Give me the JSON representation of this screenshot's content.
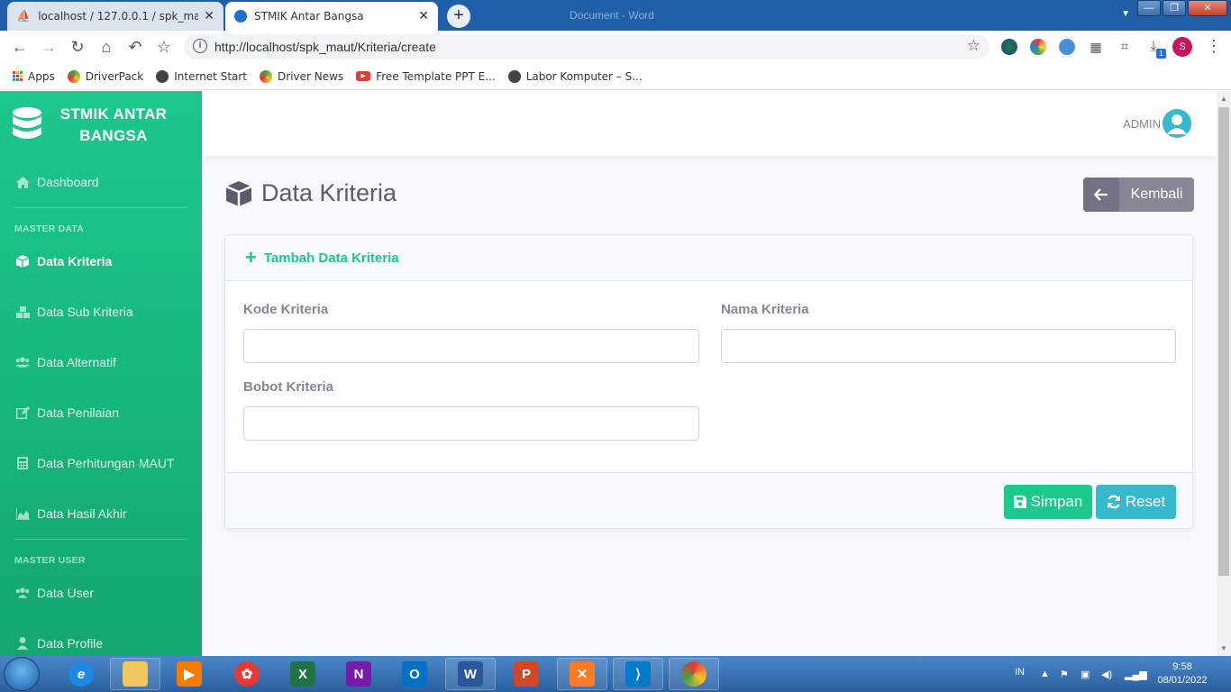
{
  "browser": {
    "tabs": [
      {
        "title": "localhost / 127.0.0.1 / spk_maut_"
      },
      {
        "title": "STMIK Antar Bangsa"
      }
    ],
    "window_title": "Document - Word",
    "url": "http://localhost/spk_maut/Kriteria/create",
    "profile_initial": "S",
    "download_badge": "1",
    "bookmarks": [
      {
        "label": "Apps"
      },
      {
        "label": "DriverPack"
      },
      {
        "label": "Internet Start"
      },
      {
        "label": "Driver News"
      },
      {
        "label": "Free Template PPT E..."
      },
      {
        "label": "Labor Komputer – S..."
      }
    ]
  },
  "sidebar": {
    "brand_line1": "STMIK ANTAR",
    "brand_line2": "BANGSA",
    "items": [
      {
        "label": "Dashboard"
      },
      {
        "label": "Data Kriteria"
      },
      {
        "label": "Data Sub Kriteria"
      },
      {
        "label": "Data Alternatif"
      },
      {
        "label": "Data Penilaian"
      },
      {
        "label": "Data Perhitungan MAUT"
      },
      {
        "label": "Data Hasil Akhir"
      },
      {
        "label": "Data User"
      },
      {
        "label": "Data Profile"
      }
    ],
    "headings": {
      "master_data": "MASTER DATA",
      "master_user": "MASTER USER"
    }
  },
  "topbar": {
    "user_name": "ADMIN"
  },
  "main": {
    "page_title": "Data Kriteria",
    "back_label": "Kembali",
    "card_title": "Tambah Data Kriteria",
    "fields": {
      "kode_label": "Kode Kriteria",
      "kode_value": "",
      "nama_label": "Nama Kriteria",
      "nama_value": "",
      "bobot_label": "Bobot Kriteria",
      "bobot_value": ""
    },
    "save_label": "Simpan",
    "reset_label": "Reset"
  },
  "taskbar": {
    "language": "IN",
    "time": "9:58",
    "date": "08/01/2022"
  },
  "colors": {
    "primary_green": "#1cc88a",
    "info_cyan": "#36b9cc",
    "secondary_gray": "#858796"
  }
}
